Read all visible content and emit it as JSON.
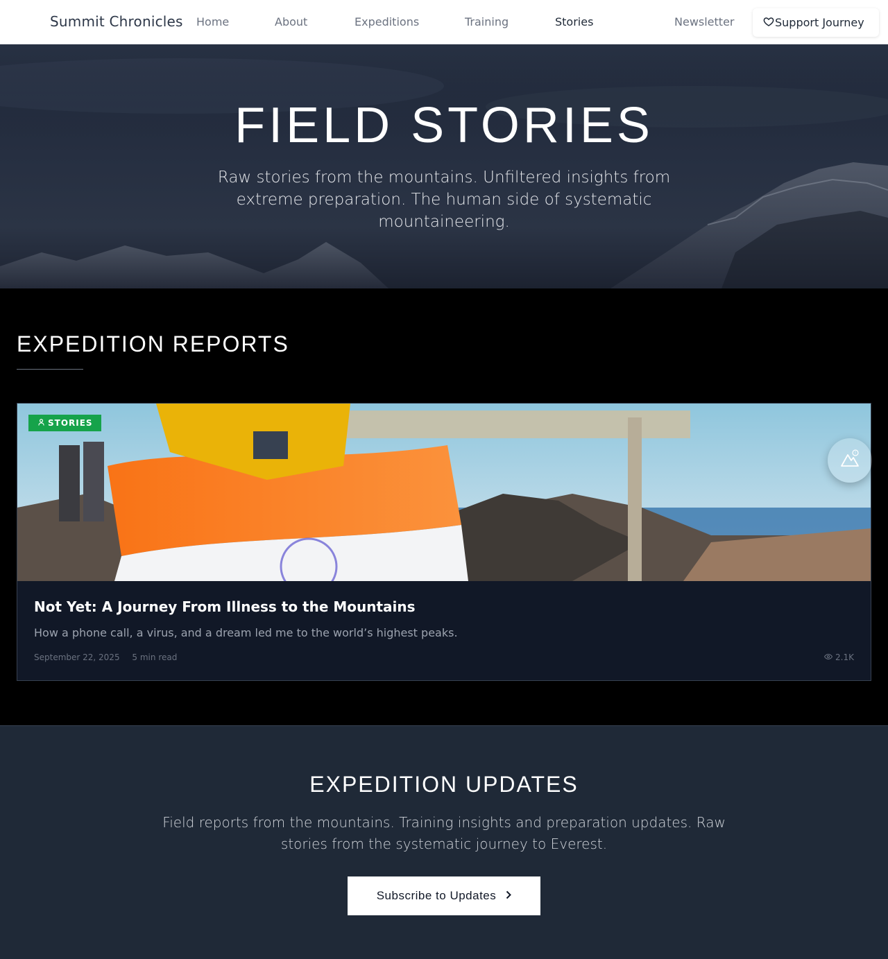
{
  "nav": {
    "brand": "Summit Chronicles",
    "links": [
      {
        "label": "Home"
      },
      {
        "label": "About"
      },
      {
        "label": "Expeditions"
      },
      {
        "label": "Training"
      },
      {
        "label": "Stories",
        "active": true
      },
      {
        "label": "Newsletter"
      }
    ],
    "support_label": "Support Journey",
    "support_icon": "heart-icon"
  },
  "hero": {
    "title": "FIELD STORIES",
    "subtitle": "Raw stories from the mountains. Unfiltered insights from extreme preparation. The human side of systematic mountaineering."
  },
  "reports": {
    "title": "EXPEDITION REPORTS",
    "card": {
      "badge": "STORIES",
      "badge_icon": "user-icon",
      "badge_color": "#16a34a",
      "title": "Not Yet: A Journey From Illness to the Mountains",
      "excerpt": "How a phone call, a virus, and a dream led me to the world’s highest peaks.",
      "date": "September 22, 2025",
      "read_time": "5 min read",
      "views": "2.1K",
      "views_icon": "eye-icon"
    }
  },
  "floating_button": {
    "icon": "mountain-icon",
    "badge": "!"
  },
  "updates": {
    "title": "EXPEDITION UPDATES",
    "text": "Field reports from the mountains. Training insights and preparation updates. Raw stories from the systematic journey to Everest.",
    "button_label": "Subscribe to Updates",
    "button_icon": "chevron-right-icon"
  }
}
